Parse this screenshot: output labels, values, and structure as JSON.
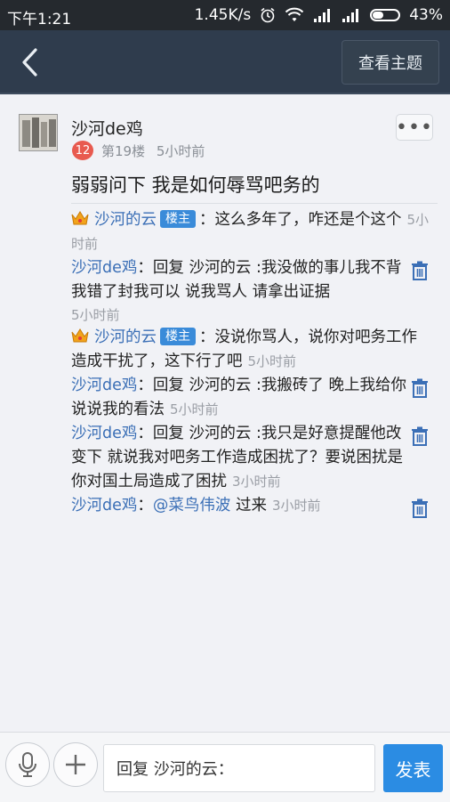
{
  "status": {
    "time": "下午1:21",
    "speed": "1.45K/s",
    "battery": "43%"
  },
  "nav": {
    "view_topic": "查看主题"
  },
  "post": {
    "author": "沙河de鸡",
    "level": "12",
    "floor": "第19楼",
    "time": "5小时前",
    "title": "弱弱问下 我是如何辱骂吧务的"
  },
  "comments": [
    {
      "user": "沙河的云",
      "badge": "楼主",
      "sep": "：",
      "text": "这么多年了，咋还是个这个",
      "time": "5小时前"
    },
    {
      "user": "沙河de鸡",
      "sep": "：",
      "text": "回复 沙河的云 :我没做的事儿我不背 我错了封我可以 说我骂人 请拿出证据",
      "time": "5小时前"
    },
    {
      "user": "沙河的云",
      "badge": "楼主",
      "sep": "：",
      "text": "没说你骂人，说你对吧务工作造成干扰了，这下行了吧",
      "time": "5小时前"
    },
    {
      "user": "沙河de鸡",
      "sep": "：",
      "text": "回复 沙河的云 :我搬砖了 晚上我给你说说我的看法",
      "time": "5小时前"
    },
    {
      "user": "沙河de鸡",
      "sep": "：",
      "text": "回复 沙河的云 :我只是好意提醒他改变下 就说我对吧务工作造成困扰了？要说困扰是你对国土局造成了困扰",
      "time": "3小时前"
    },
    {
      "user": "沙河de鸡",
      "sep": "：",
      "mention": "@菜鸟伟波",
      "text": " 过来",
      "time": "3小时前"
    }
  ],
  "bottom": {
    "reply_text": "回复 沙河的云：",
    "send": "发表"
  }
}
